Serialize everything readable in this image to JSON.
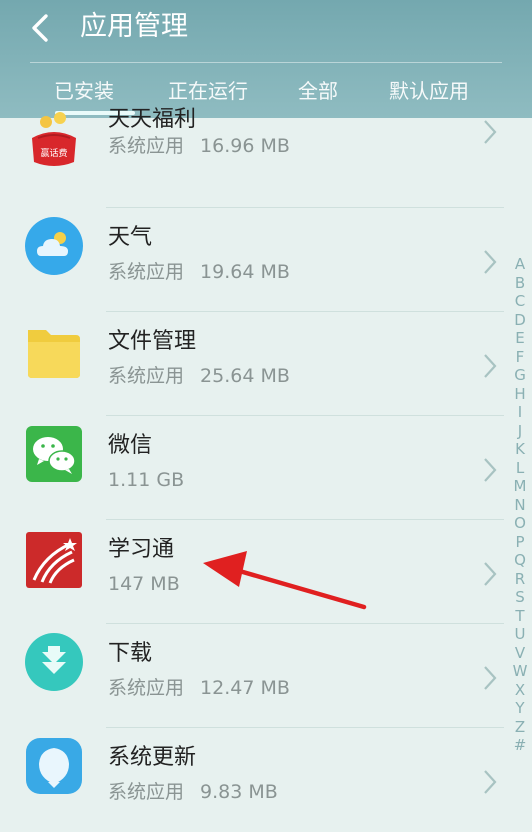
{
  "header": {
    "title": "应用管理",
    "tabs": [
      {
        "label": "已安装",
        "active": true
      },
      {
        "label": "正在运行",
        "active": false
      },
      {
        "label": "全部",
        "active": false
      },
      {
        "label": "默认应用",
        "active": false
      }
    ]
  },
  "apps": [
    {
      "name": "天天福利",
      "type": "系统应用",
      "size": "16.96 MB",
      "icon": "gift-bag-icon",
      "icon_text": "赢话费"
    },
    {
      "name": "天气",
      "type": "系统应用",
      "size": "19.64 MB",
      "icon": "weather-icon"
    },
    {
      "name": "文件管理",
      "type": "系统应用",
      "size": "25.64 MB",
      "icon": "folder-icon"
    },
    {
      "name": "微信",
      "type": "",
      "size": "1.11 GB",
      "icon": "wechat-icon"
    },
    {
      "name": "学习通",
      "type": "",
      "size": "147 MB",
      "icon": "xuexitong-icon"
    },
    {
      "name": "下载",
      "type": "系统应用",
      "size": "12.47 MB",
      "icon": "download-icon"
    },
    {
      "name": "系统更新",
      "type": "系统应用",
      "size": "9.83 MB",
      "icon": "system-update-icon"
    }
  ],
  "index_letters": [
    "A",
    "B",
    "C",
    "D",
    "E",
    "F",
    "G",
    "H",
    "I",
    "J",
    "K",
    "L",
    "M",
    "N",
    "O",
    "P",
    "Q",
    "R",
    "S",
    "T",
    "U",
    "V",
    "W",
    "X",
    "Y",
    "Z",
    "#"
  ],
  "colors": {
    "accent": "#74a8af",
    "annotation_arrow": "#e02020"
  }
}
